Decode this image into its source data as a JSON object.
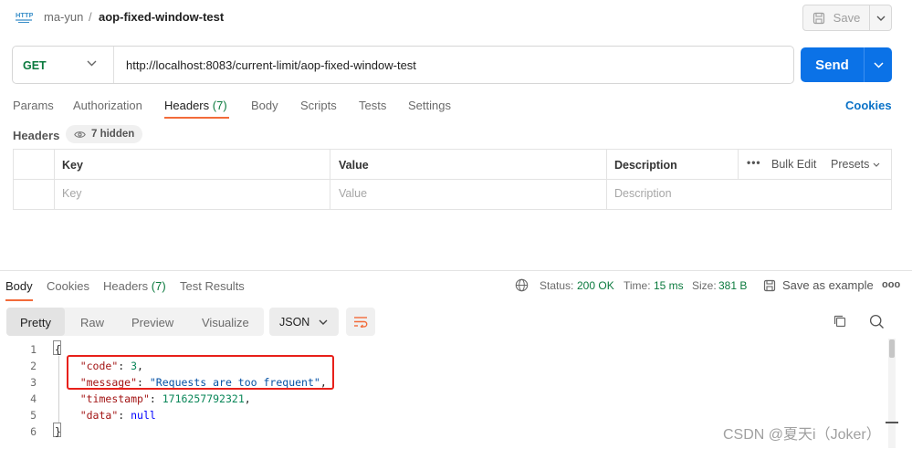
{
  "header": {
    "breadcrumb_workspace": "ma-yun",
    "breadcrumb_separator": "/",
    "request_name": "aop-fixed-window-test",
    "save_label": "Save"
  },
  "request": {
    "method": "GET",
    "url": "http://localhost:8083/current-limit/aop-fixed-window-test",
    "send_label": "Send",
    "tabs": [
      {
        "label": "Params"
      },
      {
        "label": "Authorization"
      },
      {
        "label": "Headers",
        "count": "(7)"
      },
      {
        "label": "Body"
      },
      {
        "label": "Scripts"
      },
      {
        "label": "Tests"
      },
      {
        "label": "Settings"
      }
    ],
    "active_tab": "Headers",
    "cookies_link": "Cookies",
    "headers_section_label": "Headers",
    "hidden_label": "7 hidden"
  },
  "headers_table": {
    "columns": [
      "Key",
      "Value",
      "Description"
    ],
    "bulk_edit": "Bulk Edit",
    "presets": "Presets",
    "placeholders": [
      "Key",
      "Value",
      "Description"
    ]
  },
  "response": {
    "tabs": [
      {
        "label": "Body"
      },
      {
        "label": "Cookies"
      },
      {
        "label": "Headers",
        "count": "(7)"
      },
      {
        "label": "Test Results"
      }
    ],
    "active_tab": "Body",
    "status_label": "Status:",
    "status_value": "200 OK",
    "time_label": "Time:",
    "time_value": "15 ms",
    "size_label": "Size:",
    "size_value": "381 B",
    "save_example": "Save as example",
    "views": [
      "Pretty",
      "Raw",
      "Preview",
      "Visualize"
    ],
    "active_view": "Pretty",
    "format": "JSON",
    "code_lines": [
      "1",
      "2",
      "3",
      "4",
      "5",
      "6"
    ],
    "json": {
      "open_brace": "{",
      "code_key": "\"code\"",
      "code_value": "3",
      "message_key": "\"message\"",
      "message_value": "\"Requests are too frequent\"",
      "timestamp_key": "\"timestamp\"",
      "timestamp_value": "1716257792321",
      "data_key": "\"data\"",
      "data_value": "null",
      "close_brace": "}"
    }
  },
  "watermark": "CSDN @夏天i（Joker）",
  "colors": {
    "accent": "#0b72e7",
    "tab_underline": "#f26b3a",
    "status_ok": "#0b7a3e",
    "highlight": "#e8201a"
  },
  "icons": [
    "http-icon",
    "save-icon",
    "chevron-down-icon",
    "eye-icon",
    "more-icon",
    "globe-icon",
    "copy-icon",
    "search-icon",
    "wrap-icon"
  ]
}
